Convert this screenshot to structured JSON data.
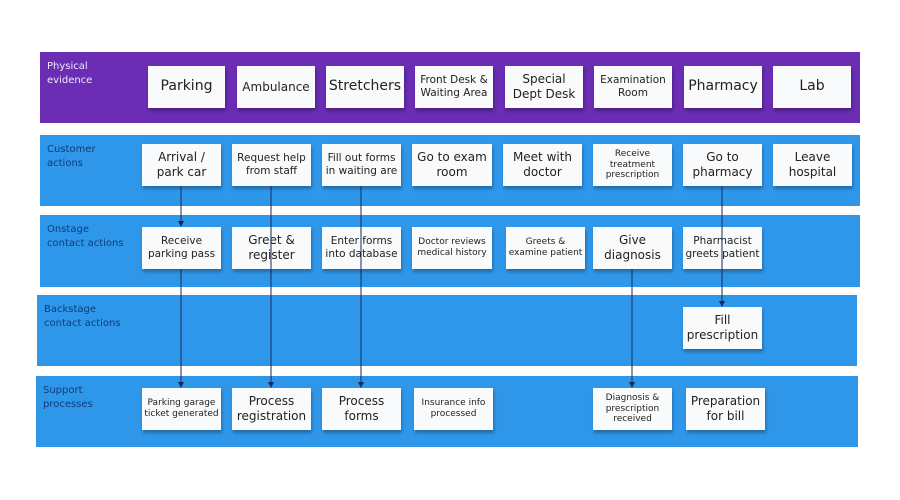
{
  "colors": {
    "physical_band": "#6a2db4",
    "lane_band": "#2e97ea",
    "card": "#f9fafb",
    "arrow": "#1a2a5a"
  },
  "lanes": [
    {
      "id": "physical",
      "label": "Physical\nevidence",
      "cards": [
        "Parking",
        "Ambulance",
        "Stretchers",
        "Front Desk &\nWaiting Area",
        "Special\nDept Desk",
        "Examination\nRoom",
        "Pharmacy",
        "Lab"
      ]
    },
    {
      "id": "customer",
      "label": "Customer\nactions",
      "cards": [
        "Arrival /\npark car",
        "Request help\nfrom staff",
        "Fill out forms\nin waiting are",
        "Go to exam\nroom",
        "Meet with\ndoctor",
        "Receive\ntreatment\nprescription",
        "Go to\npharmacy",
        "Leave\nhospital"
      ]
    },
    {
      "id": "onstage",
      "label": "Onstage\ncontact actions",
      "cards": [
        "Receive\nparking pass",
        "Greet &\nregister",
        "Enter forms\ninto database",
        "Doctor reviews\nmedical history",
        "Greets &\nexamine patient",
        "Give\ndiagnosis",
        "Pharmacist\ngreets patient"
      ]
    },
    {
      "id": "backstage",
      "label": "Backstage\ncontact actions",
      "cards": [
        "Fill\nprescription"
      ]
    },
    {
      "id": "support",
      "label": "Support\nprocesses",
      "cards": [
        "Parking garage\nticket generated",
        "Process\nregistration",
        "Process\nforms",
        "Insurance info\nprocessed",
        "Diagnosis &\nprescription\nreceived",
        "Preparation\nfor bill"
      ]
    }
  ],
  "connections": [
    {
      "from": "Arrival / park car",
      "to": "Receive parking pass"
    },
    {
      "from": "Receive parking pass",
      "to": "Parking garage ticket generated"
    },
    {
      "from": "Request help from staff",
      "to": "Process registration"
    },
    {
      "from": "Fill out forms in waiting are",
      "to": "Process forms"
    },
    {
      "from": "Give diagnosis",
      "to": "Diagnosis & prescription received"
    },
    {
      "from": "Go to pharmacy",
      "to": "Fill prescription"
    }
  ]
}
